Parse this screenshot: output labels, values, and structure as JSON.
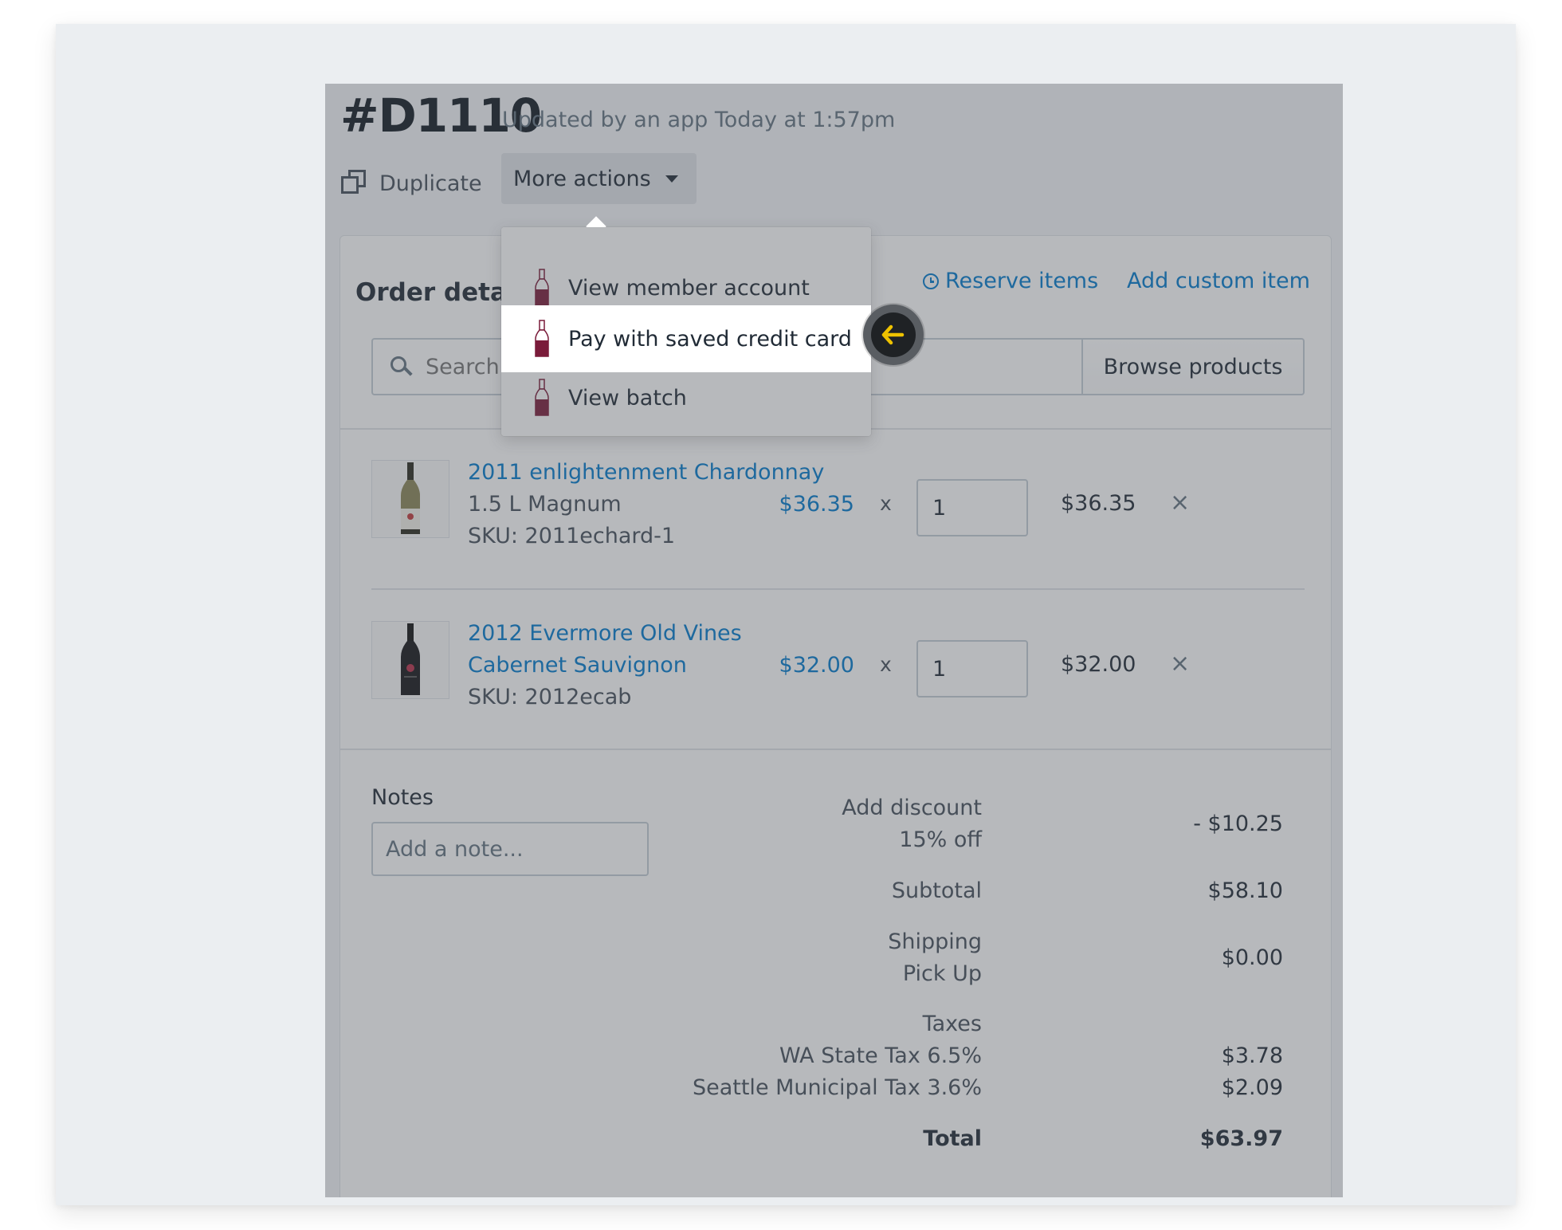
{
  "order": {
    "number": "#D1110",
    "updated": "Updated by an app Today at 1:57pm"
  },
  "toolbar": {
    "duplicate_label": "Duplicate",
    "more_actions_label": "More actions"
  },
  "dropdown": {
    "items": [
      {
        "label": "View member account",
        "icon": "wine-bottle-icon"
      },
      {
        "label": "Pay with saved credit card",
        "icon": "wine-bottle-icon",
        "highlighted": true
      },
      {
        "label": "View batch",
        "icon": "wine-bottle-icon"
      }
    ]
  },
  "card": {
    "title": "Order details",
    "reserve_label": "Reserve items",
    "add_custom_label": "Add custom item",
    "search_placeholder": "Search products",
    "browse_label": "Browse products"
  },
  "line_items": [
    {
      "name": "2011 enlightenment Chardonnay",
      "variant": "1.5 L Magnum",
      "sku": "SKU: 2011echard-1",
      "unit_price": "$36.35",
      "times": "x",
      "quantity": "1",
      "total": "$36.35",
      "remove": "×"
    },
    {
      "name_line1": "2012 Evermore Old Vines",
      "name_line2": "Cabernet Sauvignon",
      "sku": "SKU: 2012ecab",
      "unit_price": "$32.00",
      "times": "x",
      "quantity": "1",
      "total": "$32.00",
      "remove": "×"
    }
  ],
  "notes": {
    "label": "Notes",
    "placeholder": "Add a note..."
  },
  "summary": {
    "discount_label": "Add discount",
    "discount_detail": "15% off",
    "discount_value": "- $10.25",
    "subtotal_label": "Subtotal",
    "subtotal_value": "$58.10",
    "shipping_label": "Shipping",
    "shipping_detail": "Pick Up",
    "shipping_value": "$0.00",
    "taxes_label": "Taxes",
    "tax1_label": "WA State Tax 6.5%",
    "tax1_value": "$3.78",
    "tax2_label": "Seattle Municipal Tax 3.6%",
    "tax2_value": "$2.09",
    "total_label": "Total",
    "total_value": "$63.97"
  },
  "colors": {
    "link": "#007ace",
    "cursor_arrow": "#eec200",
    "wine_red": "#7a1b3a"
  },
  "cursor": {
    "icon": "arrow-left-icon"
  }
}
